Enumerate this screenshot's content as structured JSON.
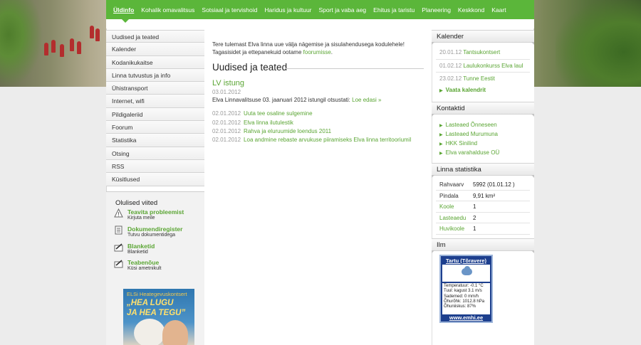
{
  "nav": {
    "items": [
      "Üldinfo",
      "Kohalik omavalitsus",
      "Sotsiaal ja tervishoid",
      "Haridus ja kultuur",
      "Sport ja vaba aeg",
      "Ehitus ja taristu",
      "Planeering",
      "Keskkond",
      "Kaart"
    ]
  },
  "left_menu": {
    "items": [
      "Uudised ja teated",
      "Kalender",
      "Kodanikukaitse",
      "Linna tutvustus ja info",
      "Ühistransport",
      "Internet, wifi",
      "Pildigaleriid",
      "Foorum",
      "Statistika",
      "Otsing",
      "RSS",
      "Küsitlused"
    ]
  },
  "useful": {
    "title": "Olulised viited",
    "links": [
      {
        "title": "Teavita probleemist",
        "sub": "Kirjuta meile"
      },
      {
        "title": "Dokumendiregister",
        "sub": "Tutvu dokumentidega"
      },
      {
        "title": "Blanketid",
        "sub": "Blanketid"
      },
      {
        "title": "Teabenõue",
        "sub": "Küsi ametnikult"
      }
    ]
  },
  "banner": {
    "line1": "ELSi Heategevuskontsert",
    "line2": "„HEA LUGU",
    "line3": "JA HEA TEGU”"
  },
  "intro": {
    "line1": "Tere tulemast Elva linna uue välja nägemise ja sisulahendusega kodulehele!",
    "line2": "Tagasisidet ja ettepanekuid ootame ",
    "link": "foorumisse",
    "after": "."
  },
  "news_title": "Uudised ja teated",
  "featured": {
    "title": "LV istung",
    "date": "03.01.2012",
    "text": "Elva Linnavalitsuse 03. jaanuari 2012 istungil otsustati: ",
    "more": "Loe edasi »"
  },
  "news": [
    {
      "date": "02.01.2012",
      "title": "Uuta tee osaline sulgemine"
    },
    {
      "date": "02.01.2012",
      "title": "Elva linna ilutulestik"
    },
    {
      "date": "02.01.2012",
      "title": "Rahva ja eluruumide loendus 2011"
    },
    {
      "date": "02.01.2012",
      "title": "Loa andmine rebaste arvukuse piiramiseks Elva linna territooriumil"
    }
  ],
  "calendar": {
    "title": "Kalender",
    "events": [
      {
        "date": "20.01.12",
        "title": "Tantsukontsert"
      },
      {
        "date": "01.02.12",
        "title": "Laulukonkurss Elva laul"
      },
      {
        "date": "23.02.12",
        "title": "Tunne Eestit"
      }
    ],
    "more": "Vaata kalendrit"
  },
  "contacts": {
    "title": "Kontaktid",
    "items": [
      "Lasteaed Õnneseen",
      "Lasteaed Murumuna",
      "HKK Sinilind",
      "Elva varahalduse OÜ"
    ]
  },
  "stats": {
    "title": "Linna statistika",
    "rows": [
      {
        "k": "Rahvaarv",
        "v": "5992 (01.01.12 )"
      },
      {
        "k": "Pindala",
        "v": "9,91 km²"
      },
      {
        "k": "Koole",
        "v": "1"
      },
      {
        "k": "Lasteaedu",
        "v": "2"
      },
      {
        "k": "Huvikoole",
        "v": "1"
      }
    ]
  },
  "weather": {
    "title": "Ilm",
    "station": "Tartu (Tõravere)",
    "lines": [
      "Temperatuur: -0.1 °C",
      "Tuul: kagust 3.1 m/s",
      "Sademed: 0 mm/h",
      "Õhurõhk: 1012.8 hPa",
      "Õhuniiskus: 87%"
    ],
    "link": "www.emhi.ee"
  },
  "colors": {
    "accent": "#5bb63a",
    "link": "#5aa533",
    "weather_bg": "#1d3f8e"
  }
}
